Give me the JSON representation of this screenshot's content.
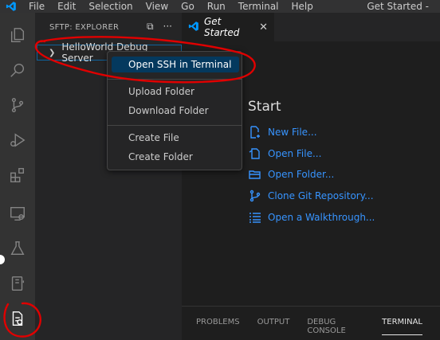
{
  "menubar": {
    "items": [
      "File",
      "Edit",
      "Selection",
      "View",
      "Go",
      "Run",
      "Terminal",
      "Help"
    ],
    "window_title": "Get Started - "
  },
  "activity_bar": {
    "icons": [
      "explorer-icon",
      "search-icon",
      "source-control-icon",
      "run-debug-icon",
      "extensions-icon",
      "remote-explorer-icon",
      "testing-icon",
      "notebook-icon",
      "sftp-icon"
    ],
    "active": "sftp-icon"
  },
  "sidebar": {
    "title": "SFTP: EXPLORER",
    "server": "HelloWorld Debug Server"
  },
  "context_menu": {
    "items": [
      {
        "label": "Open SSH in Terminal",
        "selected": true
      },
      {
        "label": "Upload Folder"
      },
      {
        "label": "Download Folder"
      },
      {
        "label": "Create File"
      },
      {
        "label": "Create Folder"
      }
    ]
  },
  "editor": {
    "tab_label": "Get Started",
    "start_heading": "Start",
    "links": [
      "New File...",
      "Open File...",
      "Open Folder...",
      "Clone Git Repository...",
      "Open a Walkthrough..."
    ]
  },
  "panel": {
    "tabs": [
      "PROBLEMS",
      "OUTPUT",
      "DEBUG CONSOLE",
      "TERMINAL"
    ],
    "active": "TERMINAL"
  },
  "colors": {
    "accent": "#3794ff",
    "selection": "#04395e",
    "annotation": "#e00000"
  }
}
